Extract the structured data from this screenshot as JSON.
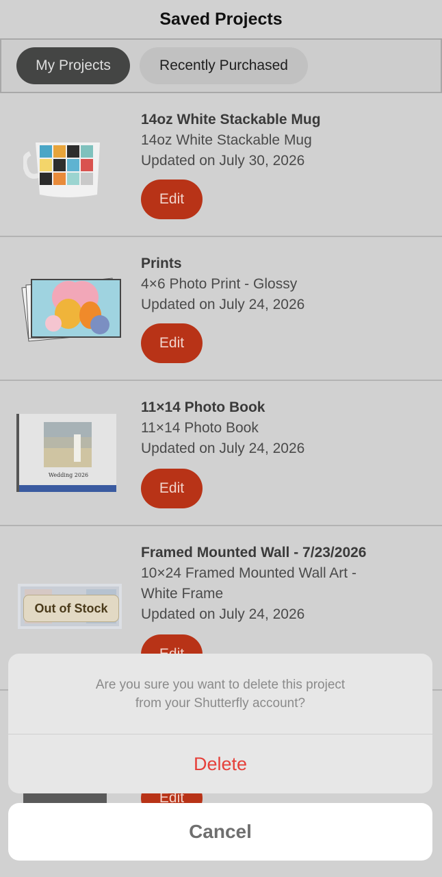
{
  "header": {
    "title": "Saved Projects"
  },
  "tabs": [
    {
      "label": "My Projects",
      "active": true
    },
    {
      "label": "Recently Purchased",
      "active": false
    }
  ],
  "projects": [
    {
      "title": "14oz White Stackable Mug",
      "subtitle": "14oz White Stackable Mug",
      "updated": "Updated on July 30, 2026",
      "edit_label": "Edit",
      "thumb": "mug-thumbnail"
    },
    {
      "title": "Prints",
      "subtitle": "4×6 Photo Print - Glossy",
      "updated": "Updated on July 24, 2026",
      "edit_label": "Edit",
      "thumb": "prints-thumbnail"
    },
    {
      "title": "11×14 Photo Book",
      "subtitle": "11×14 Photo Book",
      "updated": "Updated on July 24, 2026",
      "edit_label": "Edit",
      "thumb": "photobook-thumbnail",
      "cover_text": "Wedding 2026"
    },
    {
      "title": "Framed Mounted Wall  - 7/23/2026",
      "subtitle": "10×24 Framed Mounted Wall Art -",
      "subtitle2": "White Frame",
      "updated": "Updated on July 24, 2026",
      "edit_label": "Edit",
      "thumb": "wall-art-thumbnail",
      "badge": "Out of Stock"
    },
    {
      "edit_label": "Edit"
    }
  ],
  "dialog": {
    "message": "Are you sure you want to delete this project from your Shutterfly account?",
    "delete_label": "Delete",
    "cancel_label": "Cancel"
  },
  "colors": {
    "accent": "#b83317",
    "destructive": "#e5403a",
    "active_tab": "#444544"
  }
}
